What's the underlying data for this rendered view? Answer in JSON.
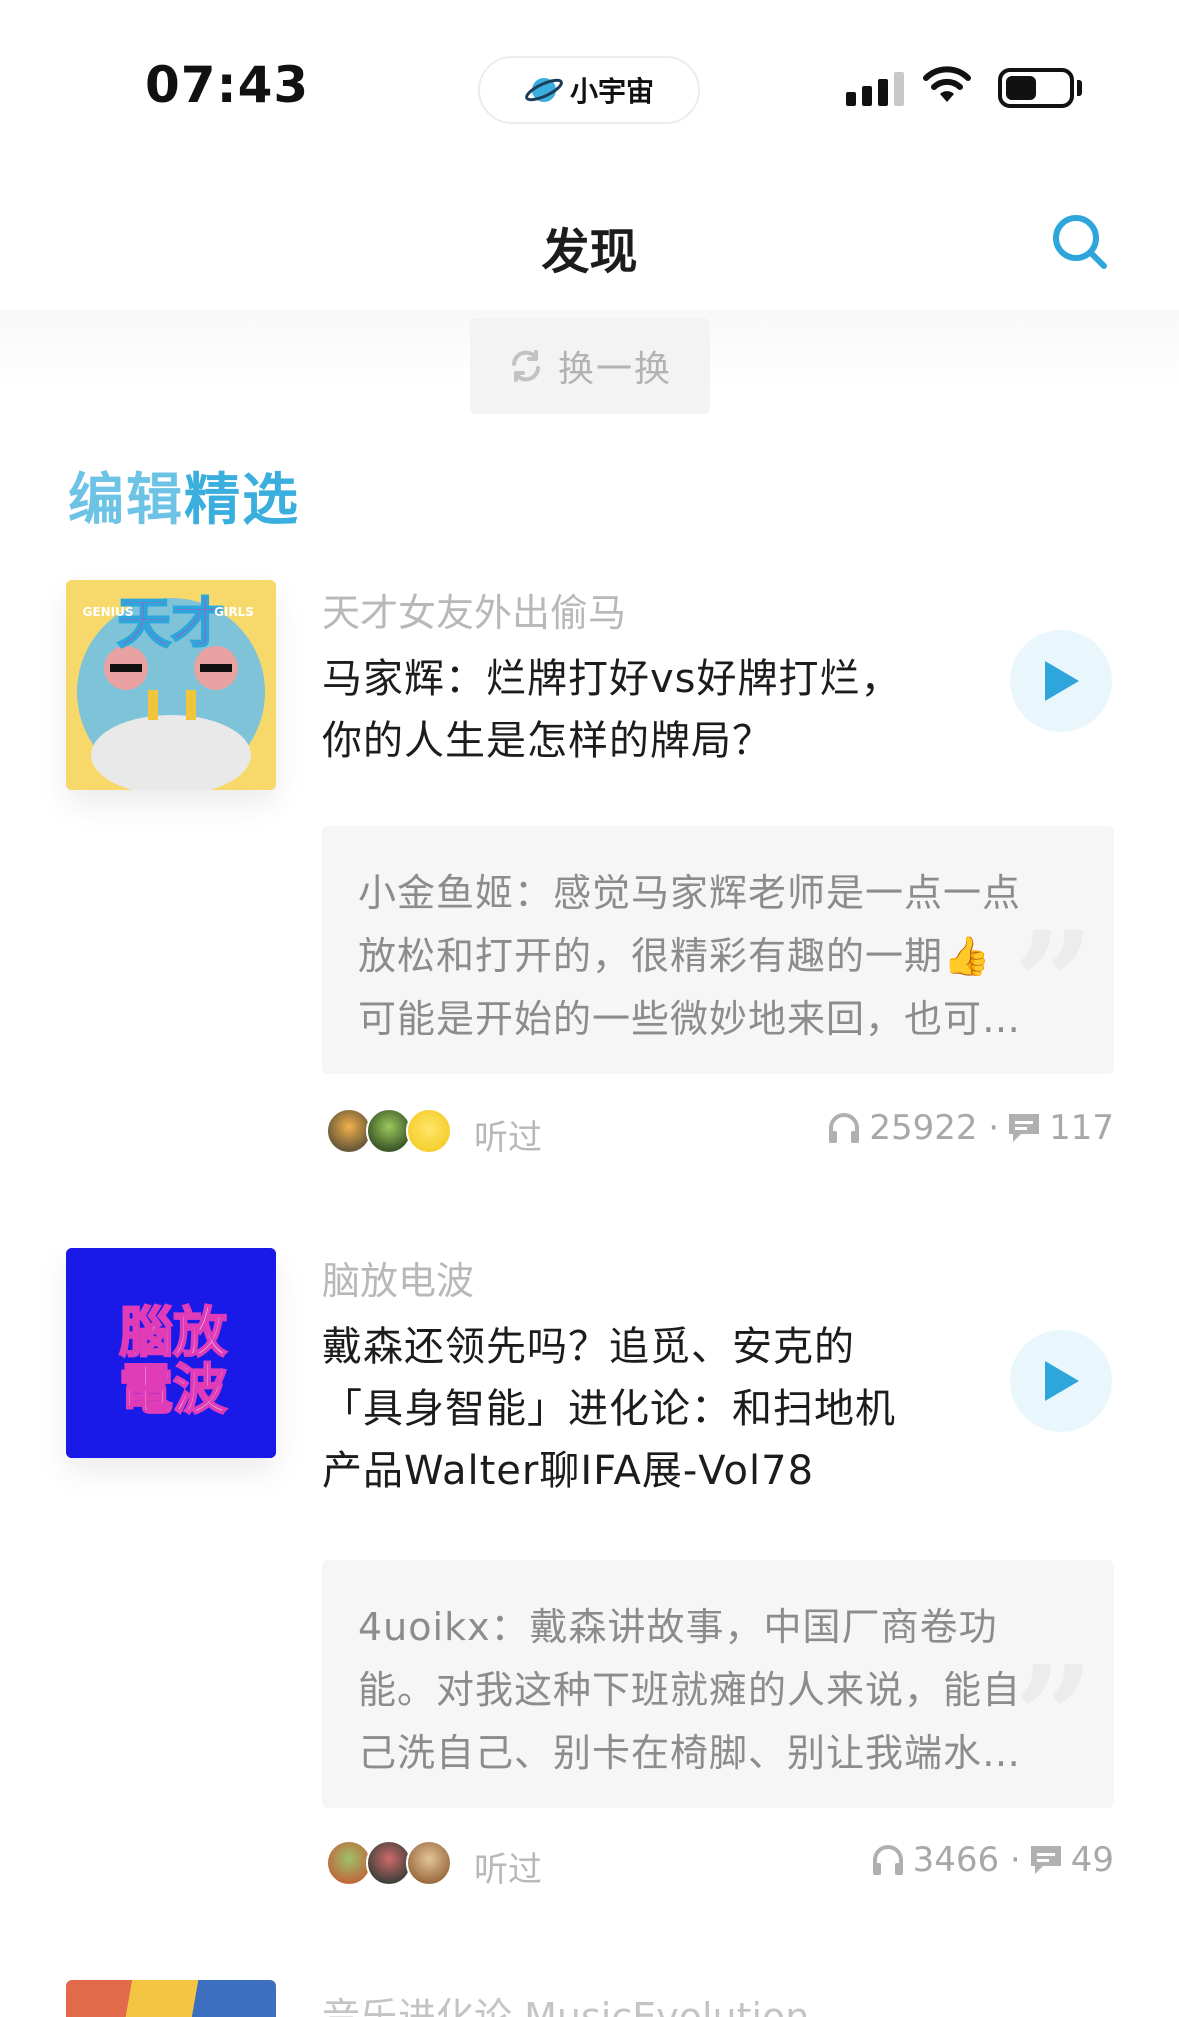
{
  "status_bar": {
    "time": "07:43",
    "app_pill": "小宇宙"
  },
  "header": {
    "title": "发现",
    "search_icon": "search-icon"
  },
  "refresh": {
    "label": "换一换",
    "icon": "refresh-icon"
  },
  "section": {
    "title_part1": "编辑",
    "title_part2": "精选"
  },
  "episodes": [
    {
      "podcast": "天才女友外出偷马",
      "title_lines": [
        "马家辉：烂牌打好vs好牌打烂，",
        "你的人生是怎样的牌局？"
      ],
      "comment_lines": [
        "小金鱼姬：感觉马家辉老师是一点一点",
        "放松和打开的，很精彩有趣的一期👍",
        "可能是开始的一些微妙地来回，也可…"
      ],
      "listened_label": "听过",
      "plays": "25922 ·",
      "comments": "117",
      "cover_text": "天才",
      "cover_sub_left": "GENIUS",
      "cover_sub_right": "GIRLS",
      "colors": {
        "cover_bg": "#f7d96b",
        "cover_circle": "#7ec3d8",
        "cover_accent": "#d13fb1"
      }
    },
    {
      "podcast": "脑放电波",
      "title_lines": [
        "戴森还领先吗？追觅、安克的",
        "「具身智能」进化论：和扫地机",
        "产品Walter聊IFA展-Vol78"
      ],
      "comment_lines": [
        "4uoikx：戴森讲故事，中国厂商卷功",
        "能。对我这种下班就瘫的人来说，能自",
        "己洗自己、别卡在椅脚、别让我端水…"
      ],
      "listened_label": "听过",
      "plays": "3466 ·",
      "comments": "49",
      "cover_text": "腦放電波",
      "colors": {
        "cover_bg": "#1a1ae8"
      }
    }
  ],
  "next_podcast": "音乐进化论 MusicEvolution",
  "colors": {
    "accent": "#3aaedc",
    "play_icon": "#2ea6dc",
    "muted": "#b8b8b8"
  }
}
